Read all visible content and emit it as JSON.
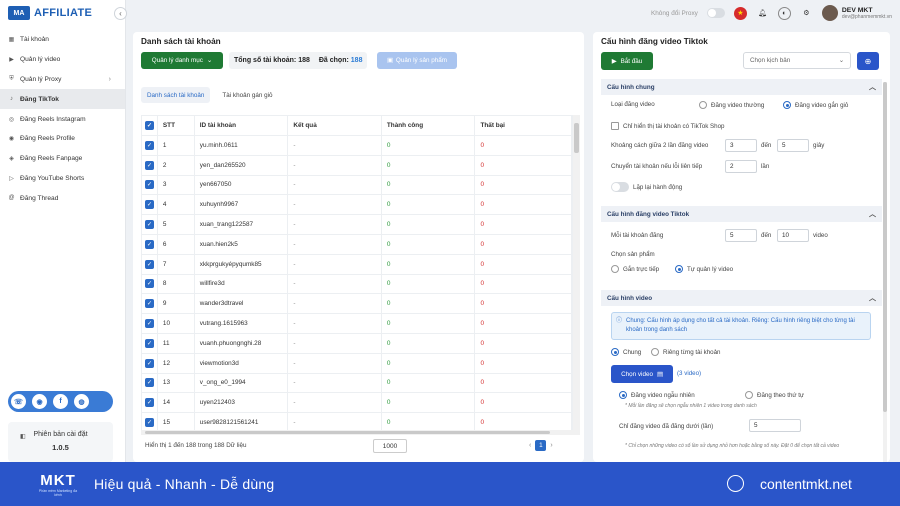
{
  "brand": {
    "logo_text": "AFFILIATE",
    "logo_mark": "MA"
  },
  "sidebar": {
    "items": [
      {
        "label": "Tài khoản",
        "icon": "account-icon"
      },
      {
        "label": "Quản lý video",
        "icon": "video-icon"
      },
      {
        "label": "Quản lý Proxy",
        "icon": "proxy-icon",
        "has_children": true
      },
      {
        "label": "Đăng TikTok",
        "icon": "tiktok-icon",
        "active": true
      },
      {
        "label": "Đăng Reels Instagram",
        "icon": "instagram-icon"
      },
      {
        "label": "Đăng Reels Profile",
        "icon": "profile-icon"
      },
      {
        "label": "Đăng Reels Fanpage",
        "icon": "fanpage-icon"
      },
      {
        "label": "Đăng YouTube Shorts",
        "icon": "youtube-icon"
      },
      {
        "label": "Đăng Thread",
        "icon": "thread-icon"
      }
    ],
    "version_label": "Phiên bản cài đặt",
    "version": "1.0.5"
  },
  "topbar": {
    "proxy_label": "Không đổi Proxy",
    "user_name": "DEV MKT",
    "user_email": "dev@phanmemmkt.vn"
  },
  "accounts_panel": {
    "title": "Danh sách tài khoản",
    "manage_button": "Quản lý danh mục",
    "total_label": "Tổng số tài khoản:",
    "total": "188",
    "selected_label": "Đã chọn:",
    "selected": "188",
    "product_button": "Quản lý sản phẩm",
    "tabs": [
      "Danh sách tài khoản",
      "Tài khoản gán giỏ"
    ],
    "columns": [
      "STT",
      "ID tài khoản",
      "Kết quả",
      "Thành công",
      "Thất bại"
    ],
    "rows": [
      [
        "1",
        "yu.minh.0611",
        "-",
        "0",
        "0"
      ],
      [
        "2",
        "yen_dan265520",
        "-",
        "0",
        "0"
      ],
      [
        "3",
        "yen667050",
        "-",
        "0",
        "0"
      ],
      [
        "4",
        "xuhuynh9967",
        "-",
        "0",
        "0"
      ],
      [
        "5",
        "xuan_trang122587",
        "-",
        "0",
        "0"
      ],
      [
        "6",
        "xuan.hien2k5",
        "-",
        "0",
        "0"
      ],
      [
        "7",
        "xkkprgukyépyqumk85",
        "-",
        "0",
        "0"
      ],
      [
        "8",
        "willfire3d",
        "-",
        "0",
        "0"
      ],
      [
        "9",
        "wander3dtravel",
        "-",
        "0",
        "0"
      ],
      [
        "10",
        "vutrang.1615963",
        "-",
        "0",
        "0"
      ],
      [
        "11",
        "vuanh.phuongnghi.28",
        "-",
        "0",
        "0"
      ],
      [
        "12",
        "viewmotion3d",
        "-",
        "0",
        "0"
      ],
      [
        "13",
        "v_ong_e0_1994",
        "-",
        "0",
        "0"
      ],
      [
        "14",
        "uyen212403",
        "-",
        "0",
        "0"
      ],
      [
        "15",
        "user9828121561241",
        "-",
        "0",
        "0"
      ]
    ],
    "footer": "Hiển thị 1 đến 188 trong 188 Dữ liệu",
    "page_size": "1000",
    "current_page": "1"
  },
  "config_panel": {
    "title": "Cấu hình đăng video Tiktok",
    "start_button": "Bắt đầu",
    "script_placeholder": "Chọn kịch bản",
    "general": {
      "header": "Cấu hình chung",
      "type_label": "Loại đăng video",
      "opt_normal": "Đăng video thường",
      "opt_cart": "Đăng video gắn giỏ",
      "shop_only": "Chỉ hiển thị tài khoản có TikTok Shop",
      "interval_label": "Khoảng cách giữa 2 lần đăng video",
      "interval_from": "3",
      "to_word": "đến",
      "interval_to": "5",
      "sec_unit": "giây",
      "switch_label": "Chuyển tài khoản nếu lỗi liên tiếp",
      "switch_value": "2",
      "times_unit": "lần",
      "repeat_label": "Lặp lại hành động"
    },
    "tiktok": {
      "header": "Cấu hình đăng video Tiktok",
      "per_account_label": "Mỗi tài khoản đăng",
      "from": "5",
      "to_word": "đến",
      "to": "10",
      "unit": "video",
      "product_label": "Chọn sản phẩm",
      "opt_direct": "Gắn trực tiếp",
      "opt_self": "Tự quản lý video"
    },
    "video": {
      "header": "Cấu hình video",
      "info": "Chung: Cấu hình áp dụng cho tất cả tài khoản. Riêng: Cấu hình riêng biệt cho từng tài khoản trong danh sách",
      "opt_common": "Chung",
      "opt_each": "Riêng từng tài khoản",
      "choose_button": "Chọn video",
      "count": "(3 video)",
      "opt_random": "Đăng video ngẫu nhiên",
      "opt_order": "Đăng theo thứ tự",
      "random_note": "* Mỗi lần đăng sẽ chọn ngẫu nhiên 1 video trong danh sách",
      "posted_label": "Chỉ đăng video đã đăng dưới (lần)",
      "posted_value": "5",
      "posted_note": "* Chỉ chọn những video có số lần sử dụng nhỏ hơn hoặc bằng số này. Đặt 0 để chọn tất cả video"
    }
  },
  "banner": {
    "logo": "MKT",
    "logo_sub": "Phần mềm Marketing đa kênh",
    "tagline": "Hiệu quả - Nhanh - Dễ dùng",
    "site": "contentmkt.net"
  },
  "colors": {
    "primary": "#2a55c9",
    "success": "#1f7a34",
    "success_text": "#2d9a3c",
    "danger": "#d32f2f"
  }
}
